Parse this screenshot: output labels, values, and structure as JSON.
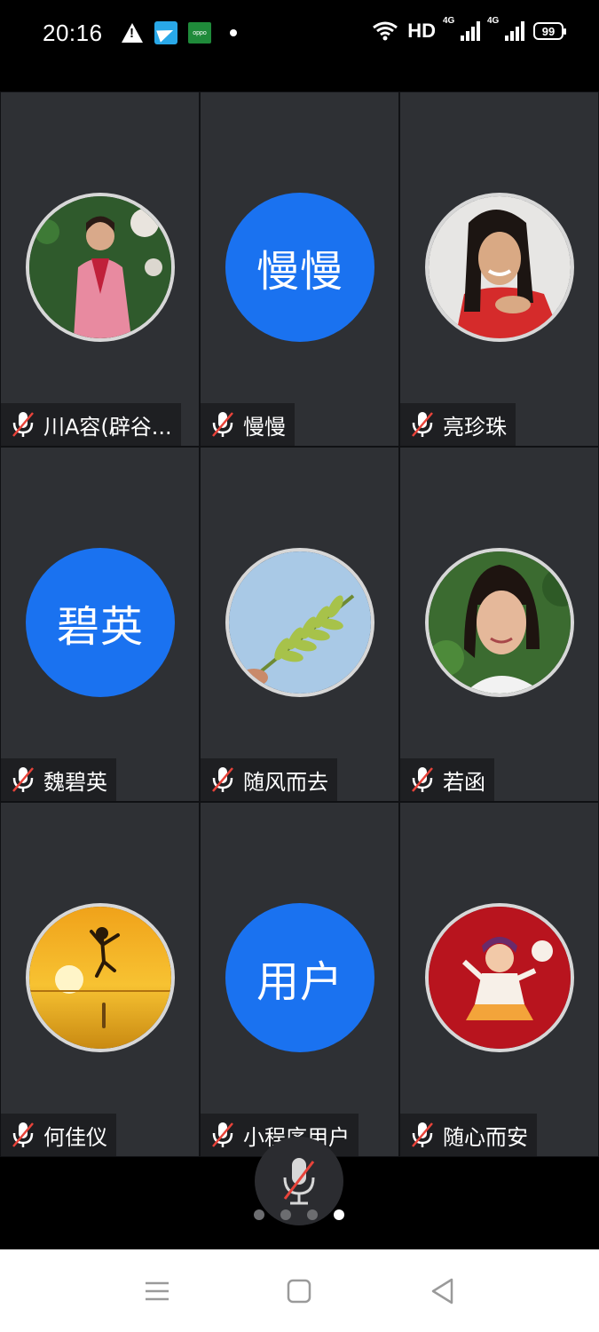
{
  "status_bar": {
    "time": "20:16",
    "left_icons": [
      "warning-icon",
      "telegram-icon",
      "oppo-app-icon",
      "notification-dot-icon"
    ],
    "oppo_label": "oppo",
    "hd_label": "HD",
    "signal1_label": "4G",
    "signal2_label": "4G",
    "battery": "99"
  },
  "participants": [
    {
      "name": "川A容(辟谷...",
      "avatar_type": "photo",
      "photo": "woman-pink-dress",
      "muted": true
    },
    {
      "name": "慢慢",
      "avatar_type": "text",
      "avatar_text": "慢慢",
      "muted": true
    },
    {
      "name": "亮珍珠",
      "avatar_type": "photo",
      "photo": "woman-red-top",
      "muted": true
    },
    {
      "name": "魏碧英",
      "avatar_type": "text",
      "avatar_text": "碧英",
      "muted": true
    },
    {
      "name": "随风而去",
      "avatar_type": "photo",
      "photo": "leaf-sky",
      "muted": true
    },
    {
      "name": "若函",
      "avatar_type": "photo",
      "photo": "woman-portrait",
      "muted": true
    },
    {
      "name": "何佳仪",
      "avatar_type": "photo",
      "photo": "sunset-jump",
      "muted": true
    },
    {
      "name": "小程序用户",
      "avatar_type": "text",
      "avatar_text": "用户",
      "muted": true
    },
    {
      "name": "随心而安",
      "avatar_type": "photo",
      "photo": "cartoon-red",
      "muted": true
    }
  ],
  "controls": {
    "mic_button": "mic-muted-icon",
    "pages": 4,
    "current_page": 4
  },
  "nav_bar": {
    "icons": [
      "menu-icon",
      "home-icon",
      "back-icon"
    ]
  },
  "colors": {
    "tile_bg": "#2e3034",
    "avatar_blue": "#1a72f0",
    "mute_red": "#e8433a"
  }
}
